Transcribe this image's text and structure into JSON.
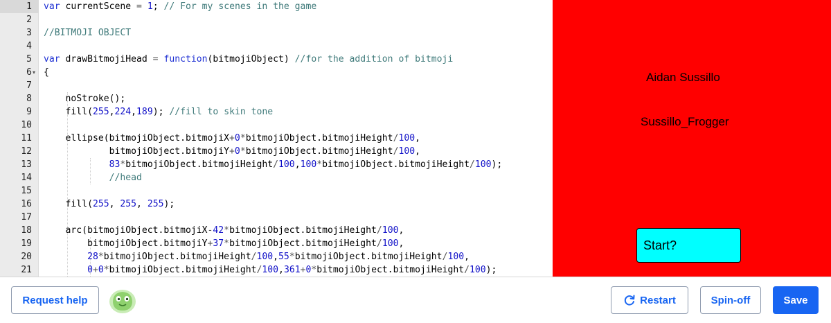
{
  "editor": {
    "lines": [
      {
        "n": "1",
        "fold": false,
        "tokens": [
          [
            "kw",
            "var"
          ],
          [
            "",
            " currentScene "
          ],
          [
            "op",
            "="
          ],
          [
            "",
            " "
          ],
          [
            "num",
            "1"
          ],
          [
            "",
            "; "
          ],
          [
            "cm",
            "// For my scenes in the game"
          ]
        ]
      },
      {
        "n": "2",
        "fold": false,
        "tokens": []
      },
      {
        "n": "3",
        "fold": false,
        "tokens": [
          [
            "cm",
            "//BITMOJI OBJECT"
          ]
        ]
      },
      {
        "n": "4",
        "fold": false,
        "tokens": []
      },
      {
        "n": "5",
        "fold": false,
        "tokens": [
          [
            "kw",
            "var"
          ],
          [
            "",
            " drawBitmojiHead "
          ],
          [
            "op",
            "="
          ],
          [
            "",
            " "
          ],
          [
            "kw",
            "function"
          ],
          [
            "",
            "(bitmojiObject) "
          ],
          [
            "cm",
            "//for the addition of bitmoji"
          ]
        ]
      },
      {
        "n": "6",
        "fold": true,
        "tokens": [
          [
            "",
            "{"
          ]
        ]
      },
      {
        "n": "7",
        "fold": false,
        "tokens": []
      },
      {
        "n": "8",
        "fold": false,
        "tokens": [
          [
            "",
            "    noStroke();"
          ]
        ]
      },
      {
        "n": "9",
        "fold": false,
        "tokens": [
          [
            "",
            "    fill("
          ],
          [
            "num",
            "255"
          ],
          [
            "",
            ","
          ],
          [
            "num",
            "224"
          ],
          [
            "",
            ","
          ],
          [
            "num",
            "189"
          ],
          [
            "",
            "); "
          ],
          [
            "cm",
            "//fill to skin tone"
          ]
        ]
      },
      {
        "n": "10",
        "fold": false,
        "tokens": []
      },
      {
        "n": "11",
        "fold": false,
        "tokens": [
          [
            "",
            "    ellipse(bitmojiObject.bitmojiX"
          ],
          [
            "op",
            "+"
          ],
          [
            "num",
            "0"
          ],
          [
            "op",
            "*"
          ],
          [
            "",
            "bitmojiObject.bitmojiHeight"
          ],
          [
            "op",
            "/"
          ],
          [
            "num",
            "100"
          ],
          [
            "",
            ","
          ]
        ]
      },
      {
        "n": "12",
        "fold": false,
        "tokens": [
          [
            "",
            "            bitmojiObject.bitmojiY"
          ],
          [
            "op",
            "+"
          ],
          [
            "num",
            "0"
          ],
          [
            "op",
            "*"
          ],
          [
            "",
            "bitmojiObject.bitmojiHeight"
          ],
          [
            "op",
            "/"
          ],
          [
            "num",
            "100"
          ],
          [
            "",
            ","
          ]
        ]
      },
      {
        "n": "13",
        "fold": false,
        "tokens": [
          [
            "",
            "            "
          ],
          [
            "num",
            "83"
          ],
          [
            "op",
            "*"
          ],
          [
            "",
            "bitmojiObject.bitmojiHeight"
          ],
          [
            "op",
            "/"
          ],
          [
            "num",
            "100"
          ],
          [
            "",
            ","
          ],
          [
            "num",
            "100"
          ],
          [
            "op",
            "*"
          ],
          [
            "",
            "bitmojiObject.bitmojiHeight"
          ],
          [
            "op",
            "/"
          ],
          [
            "num",
            "100"
          ],
          [
            "",
            ");"
          ]
        ]
      },
      {
        "n": "14",
        "fold": false,
        "tokens": [
          [
            "",
            "            "
          ],
          [
            "cm",
            "//head"
          ]
        ]
      },
      {
        "n": "15",
        "fold": false,
        "tokens": []
      },
      {
        "n": "16",
        "fold": false,
        "tokens": [
          [
            "",
            "    fill("
          ],
          [
            "num",
            "255"
          ],
          [
            "",
            ", "
          ],
          [
            "num",
            "255"
          ],
          [
            "",
            ", "
          ],
          [
            "num",
            "255"
          ],
          [
            "",
            ");"
          ]
        ]
      },
      {
        "n": "17",
        "fold": false,
        "tokens": []
      },
      {
        "n": "18",
        "fold": false,
        "tokens": [
          [
            "",
            "    arc(bitmojiObject.bitmojiX"
          ],
          [
            "op",
            "-"
          ],
          [
            "num",
            "42"
          ],
          [
            "op",
            "*"
          ],
          [
            "",
            "bitmojiObject.bitmojiHeight"
          ],
          [
            "op",
            "/"
          ],
          [
            "num",
            "100"
          ],
          [
            "",
            ","
          ]
        ]
      },
      {
        "n": "19",
        "fold": false,
        "tokens": [
          [
            "",
            "        bitmojiObject.bitmojiY"
          ],
          [
            "op",
            "+"
          ],
          [
            "num",
            "37"
          ],
          [
            "op",
            "*"
          ],
          [
            "",
            "bitmojiObject.bitmojiHeight"
          ],
          [
            "op",
            "/"
          ],
          [
            "num",
            "100"
          ],
          [
            "",
            ","
          ]
        ]
      },
      {
        "n": "20",
        "fold": false,
        "tokens": [
          [
            "",
            "        "
          ],
          [
            "num",
            "28"
          ],
          [
            "op",
            "*"
          ],
          [
            "",
            "bitmojiObject.bitmojiHeight"
          ],
          [
            "op",
            "/"
          ],
          [
            "num",
            "100"
          ],
          [
            "",
            ","
          ],
          [
            "num",
            "55"
          ],
          [
            "op",
            "*"
          ],
          [
            "",
            "bitmojiObject.bitmojiHeight"
          ],
          [
            "op",
            "/"
          ],
          [
            "num",
            "100"
          ],
          [
            "",
            ","
          ]
        ]
      },
      {
        "n": "21",
        "fold": false,
        "tokens": [
          [
            "",
            "        "
          ],
          [
            "num",
            "0"
          ],
          [
            "op",
            "+"
          ],
          [
            "num",
            "0"
          ],
          [
            "op",
            "*"
          ],
          [
            "",
            "bitmojiObject.bitmojiHeight"
          ],
          [
            "op",
            "/"
          ],
          [
            "num",
            "100"
          ],
          [
            "",
            ","
          ],
          [
            "num",
            "361"
          ],
          [
            "op",
            "+"
          ],
          [
            "num",
            "0"
          ],
          [
            "op",
            "*"
          ],
          [
            "",
            "bitmojiObject.bitmojiHeight"
          ],
          [
            "op",
            "/"
          ],
          [
            "num",
            "100"
          ],
          [
            "",
            ");"
          ]
        ]
      }
    ]
  },
  "canvas": {
    "background": "#ff0000",
    "author_name": "Aidan Sussillo",
    "username": "Sussillo_Frogger",
    "start_label": "Start?",
    "start_color": "#00ffff"
  },
  "toolbar": {
    "request_help_label": "Request help",
    "avatar_icon": "green-blob-avatar-icon",
    "restart_label": "Restart",
    "restart_icon": "refresh-icon",
    "spinoff_label": "Spin-off",
    "save_label": "Save",
    "accent_color": "#1865f2"
  }
}
